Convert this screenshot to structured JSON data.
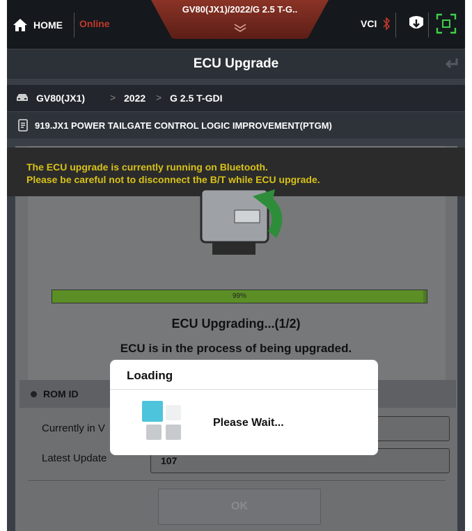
{
  "topbar": {
    "home_label": "HOME",
    "status": "Online",
    "vehicle": "GV80(JX1)/2022/G 2.5 T-G..",
    "vci_label": "VCI"
  },
  "titlebar": {
    "title": "ECU Upgrade"
  },
  "breadcrumb": {
    "model": "GV80(JX1)",
    "year": "2022",
    "engine": "G 2.5 T-GDI",
    "separator": ">"
  },
  "upgrade_item": "919.JX1 POWER TAILGATE CONTROL LOGIC IMPROVEMENT(PTGM)",
  "warning": {
    "line1": "The ECU upgrade is currently running on Bluetooth.",
    "line2": "Please be careful not to disconnect the B/T while ECU upgrade."
  },
  "progress": {
    "percent": 99,
    "label": "99%"
  },
  "status_title": "ECU Upgrading...(1/2)",
  "status_desc": "ECU is in the process of being upgraded.",
  "rom": {
    "header": "ROM ID",
    "current_label": "Currently in V",
    "current_value": "",
    "latest_label": "Latest Update",
    "latest_value": "107"
  },
  "ok_label": "OK",
  "modal": {
    "title": "Loading",
    "message": "Please Wait..."
  },
  "colors": {
    "accent_online": "#c0392b",
    "warning_text": "#d8c21a",
    "spinner_blue": "#4ec3dc",
    "progress": "#5b8f26"
  }
}
